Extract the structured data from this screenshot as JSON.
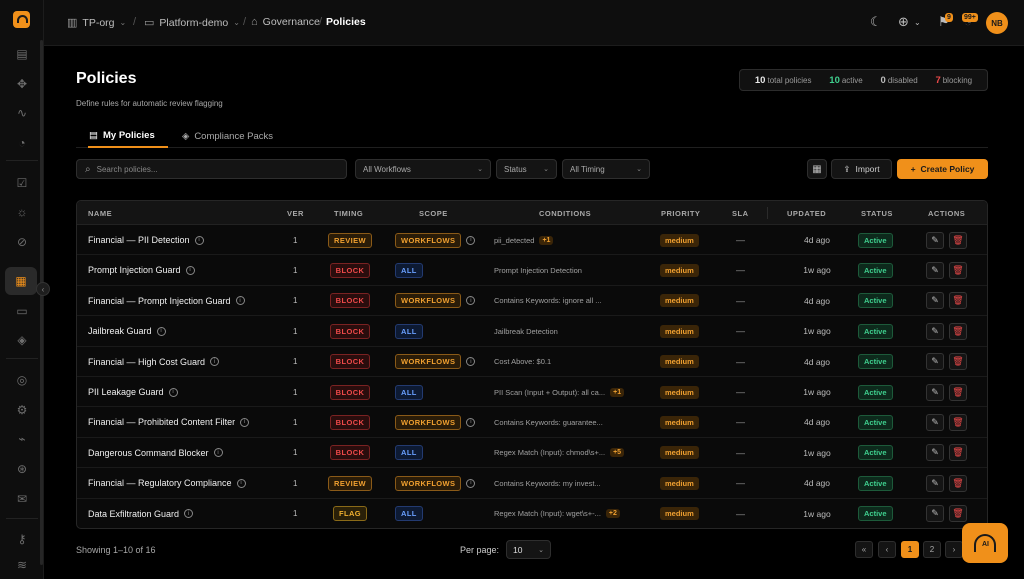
{
  "breadcrumbs": {
    "org": "TP-org",
    "project": "Platform-demo",
    "section": "Governance",
    "current": "Policies"
  },
  "topbar": {
    "notifications_count": "9",
    "alerts_count": "99+",
    "avatar_initials": "NB"
  },
  "header": {
    "title": "Policies",
    "subtitle": "Define rules for automatic review flagging"
  },
  "stats": {
    "total": "10",
    "total_label": "total policies",
    "active": "10",
    "active_label": "active",
    "disabled": "0",
    "disabled_label": "disabled",
    "blocking": "7",
    "blocking_label": "blocking"
  },
  "tabs": [
    {
      "label": "My Policies",
      "active": true
    },
    {
      "label": "Compliance Packs",
      "active": false
    }
  ],
  "toolbar": {
    "search_placeholder": "Search policies...",
    "workflow_filter": "All Workflows",
    "status_filter": "Status",
    "timing_filter": "All Timing",
    "import_label": "Import",
    "create_label": "Create Policy"
  },
  "table": {
    "headers": [
      "NAME",
      "VER",
      "TIMING",
      "SCOPE",
      "CONDITIONS",
      "PRIORITY",
      "SLA",
      "UPDATED",
      "STATUS",
      "ACTIONS"
    ],
    "rows": [
      {
        "name": "Financial — PII Detection",
        "ver": "1",
        "timing": "REVIEW",
        "scope": "WORKFLOWS",
        "conditions": "pii_detected",
        "extra": "+1",
        "priority": "medium",
        "sla": "—",
        "updated": "4d ago",
        "status": "Active"
      },
      {
        "name": "Prompt Injection Guard",
        "ver": "1",
        "timing": "BLOCK",
        "scope": "ALL",
        "conditions": "Prompt Injection Detection",
        "extra": "",
        "priority": "medium",
        "sla": "—",
        "updated": "1w ago",
        "status": "Active"
      },
      {
        "name": "Financial — Prompt Injection Guard",
        "ver": "1",
        "timing": "BLOCK",
        "scope": "WORKFLOWS",
        "conditions": "Contains Keywords: ignore all ...",
        "extra": "",
        "priority": "medium",
        "sla": "—",
        "updated": "4d ago",
        "status": "Active"
      },
      {
        "name": "Jailbreak Guard",
        "ver": "1",
        "timing": "BLOCK",
        "scope": "ALL",
        "conditions": "Jailbreak Detection",
        "extra": "",
        "priority": "medium",
        "sla": "—",
        "updated": "1w ago",
        "status": "Active"
      },
      {
        "name": "Financial — High Cost Guard",
        "ver": "1",
        "timing": "BLOCK",
        "scope": "WORKFLOWS",
        "conditions": "Cost Above: $0.1",
        "extra": "",
        "priority": "medium",
        "sla": "—",
        "updated": "4d ago",
        "status": "Active"
      },
      {
        "name": "PII Leakage Guard",
        "ver": "1",
        "timing": "BLOCK",
        "scope": "ALL",
        "conditions": "PII Scan (Input + Output): all ca...",
        "extra": "+1",
        "priority": "medium",
        "sla": "—",
        "updated": "1w ago",
        "status": "Active"
      },
      {
        "name": "Financial — Prohibited Content Filter",
        "ver": "1",
        "timing": "BLOCK",
        "scope": "WORKFLOWS",
        "conditions": "Contains Keywords: guarantee...",
        "extra": "",
        "priority": "medium",
        "sla": "—",
        "updated": "4d ago",
        "status": "Active"
      },
      {
        "name": "Dangerous Command Blocker",
        "ver": "1",
        "timing": "BLOCK",
        "scope": "ALL",
        "conditions": "Regex Match (Input): chmod\\s+...",
        "extra": "+5",
        "priority": "medium",
        "sla": "—",
        "updated": "1w ago",
        "status": "Active"
      },
      {
        "name": "Financial — Regulatory Compliance",
        "ver": "1",
        "timing": "REVIEW",
        "scope": "WORKFLOWS",
        "conditions": "Contains Keywords: my invest...",
        "extra": "",
        "priority": "medium",
        "sla": "—",
        "updated": "4d ago",
        "status": "Active"
      },
      {
        "name": "Data Exfiltration Guard",
        "ver": "1",
        "timing": "FLAG",
        "scope": "ALL",
        "conditions": "Regex Match (Input): wget\\s+-...",
        "extra": "+2",
        "priority": "medium",
        "sla": "—",
        "updated": "1w ago",
        "status": "Active"
      }
    ]
  },
  "footer": {
    "showing": "Showing 1–10 of 16",
    "per_page_label": "Per page:",
    "per_page_value": "10",
    "pages": [
      "«",
      "‹",
      "1",
      "2",
      "›"
    ],
    "current_page": "1"
  },
  "fab": {
    "label": "AI"
  },
  "colors": {
    "accent": "#f0901a",
    "active_green": "#3fcf8e",
    "block_red": "#ef4a4a",
    "scope_blue": "#6aa0ff"
  },
  "icons": {
    "sidebar": [
      "layout-icon",
      "move-icon",
      "activity-icon",
      "bell-icon",
      "check-square-icon",
      "sun-icon",
      "search-circle-icon",
      "policies-icon",
      "file-icon",
      "shield-icon",
      "target-icon",
      "settings-icon",
      "pulse-icon",
      "bug-icon",
      "mail-icon",
      "key-icon",
      "layers-icon"
    ]
  }
}
